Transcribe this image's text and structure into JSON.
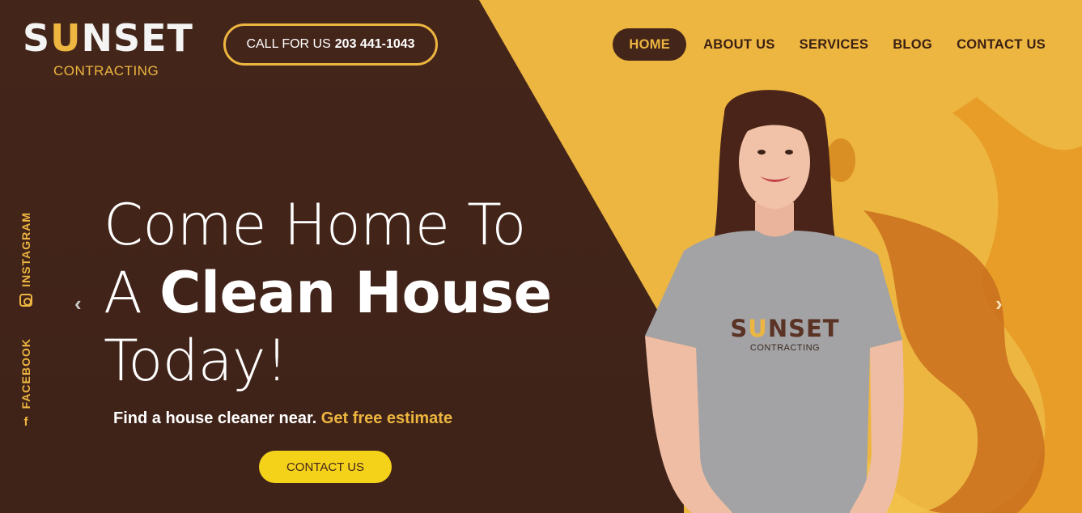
{
  "brand": {
    "logo_main_pre": "S",
    "logo_main_u": "U",
    "logo_main_post": "NSET",
    "logo_sub": "CONTRACTING"
  },
  "call": {
    "label": "CALL FOR US",
    "number": "203 441-1043"
  },
  "nav": {
    "items": [
      "HOME",
      "ABOUT US",
      "SERVICES",
      "BLOG",
      "CONTACT US"
    ],
    "active": "HOME"
  },
  "social": {
    "instagram": "INSTAGRAM",
    "facebook": "FACEBOOK"
  },
  "hero": {
    "line1": "Come Home To",
    "line2_light": "A ",
    "line2_bold": "Clean House",
    "line3": "Today!",
    "sub_text": "Find a house cleaner near.",
    "sub_highlight": "Get free estimate",
    "cta_label": "CONTACT US"
  },
  "shirt": {
    "logo_main_pre": "S",
    "logo_main_u": "U",
    "logo_main_post": "NSET",
    "logo_sub": "CONTRACTING"
  },
  "colors": {
    "brown": "#44251a",
    "yellow": "#edb640",
    "cta_yellow": "#f5d21a"
  },
  "icons": {
    "prev": "chevron-left-icon",
    "next": "chevron-right-icon"
  }
}
